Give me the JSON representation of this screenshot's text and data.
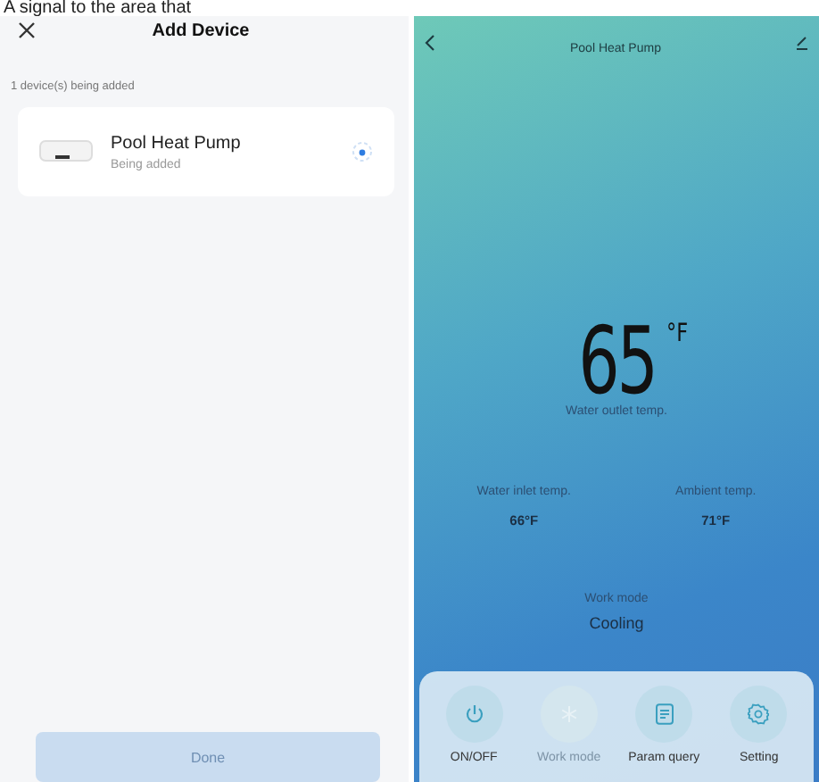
{
  "top_caption": "A signal to the area that",
  "add_device": {
    "title": "Add Device",
    "status": "1 device(s) being added",
    "devices": [
      {
        "name": "Pool Heat Pump",
        "status": "Being added"
      }
    ],
    "done_button": {
      "label": "Done",
      "disabled": true
    }
  },
  "device_panel": {
    "title": "Pool Heat Pump",
    "temperature": "65",
    "unit": "°F",
    "temperature_label": "Water outlet temp.",
    "readings": [
      {
        "label": "Water inlet temp.",
        "value": "66°F"
      },
      {
        "label": "Ambient temp.",
        "value": "71°F"
      }
    ],
    "mode_label": "Work mode",
    "mode_value": "Cooling",
    "controls": [
      {
        "kind": "power",
        "label": "ON/OFF",
        "disabled": false
      },
      {
        "kind": "mode",
        "label": "Work mode",
        "disabled": true
      },
      {
        "kind": "query",
        "label": "Param query",
        "disabled": false
      },
      {
        "kind": "setting",
        "label": "Setting",
        "disabled": false
      }
    ]
  }
}
